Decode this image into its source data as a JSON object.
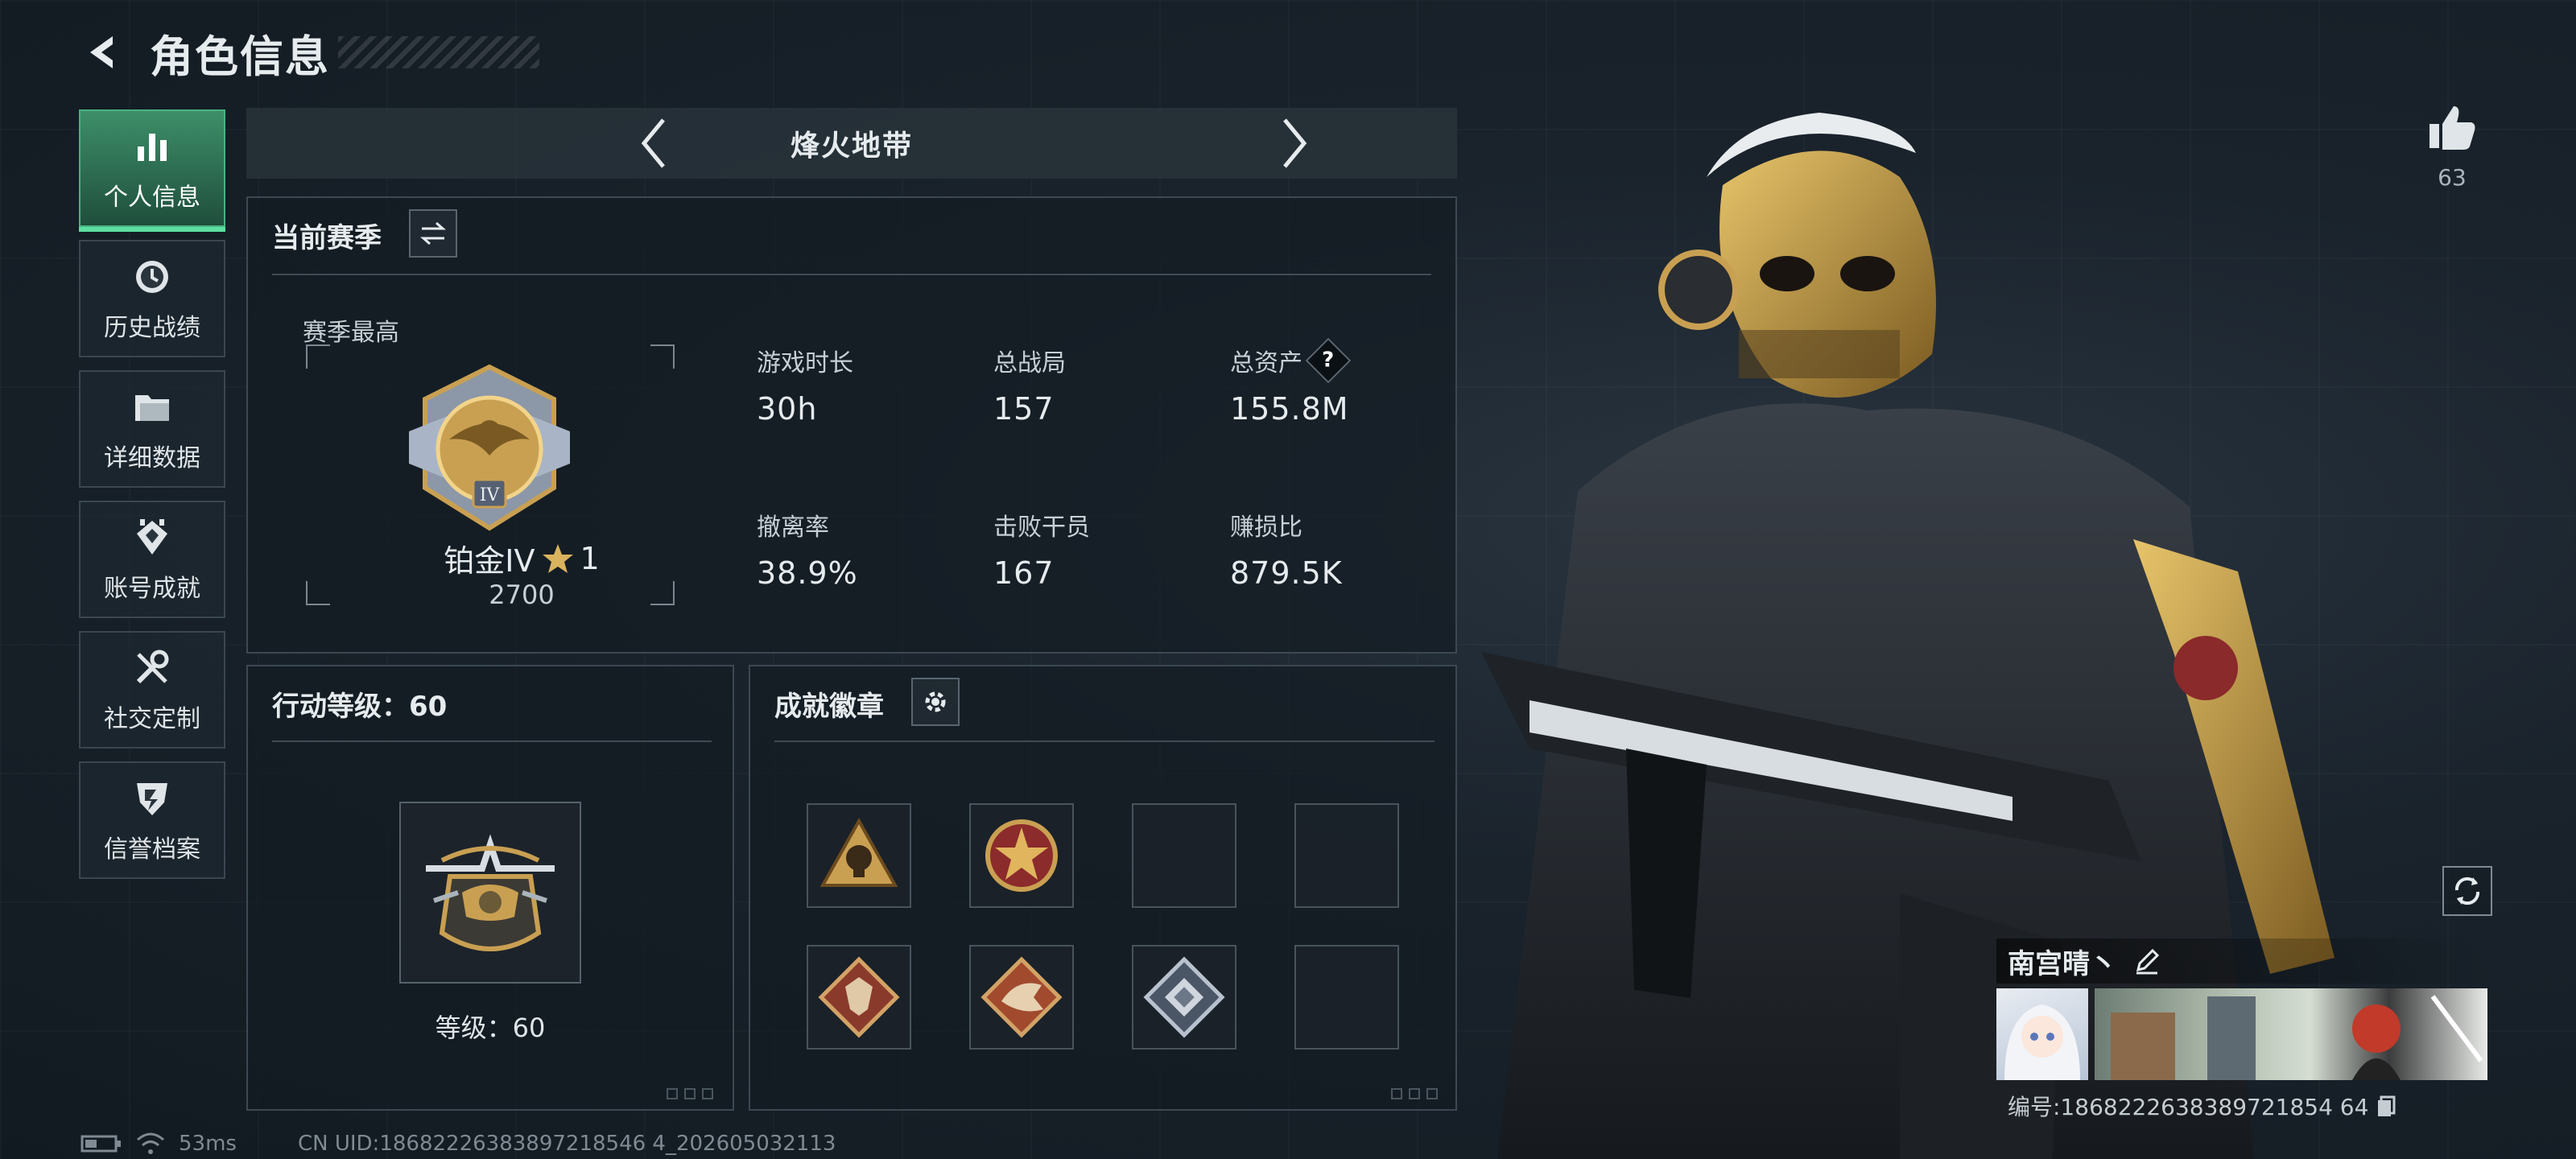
{
  "header": {
    "title": "角色信息"
  },
  "sidebar": {
    "items": [
      {
        "label": "个人信息",
        "icon": "bar-chart-icon",
        "active": true
      },
      {
        "label": "历史战绩",
        "icon": "clock-icon",
        "active": false
      },
      {
        "label": "详细数据",
        "icon": "folder-icon",
        "active": false
      },
      {
        "label": "账号成就",
        "icon": "achievement-icon",
        "active": false
      },
      {
        "label": "社交定制",
        "icon": "tools-icon",
        "active": false
      },
      {
        "label": "信誉档案",
        "icon": "shield-icon",
        "active": false
      }
    ]
  },
  "mode": {
    "name": "烽火地带"
  },
  "season": {
    "title": "当前赛季",
    "best_label": "赛季最高",
    "rank_name": "铂金IV",
    "rank_stars": "1",
    "rank_score": "2700",
    "rank_emblem_numeral": "IV",
    "stats": [
      {
        "label": "游戏时长",
        "value": "30h",
        "help": false
      },
      {
        "label": "总战局",
        "value": "157",
        "help": false
      },
      {
        "label": "总资产",
        "value": "155.8M",
        "help": true
      },
      {
        "label": "撤离率",
        "value": "38.9%",
        "help": false
      },
      {
        "label": "击败干员",
        "value": "167",
        "help": false
      },
      {
        "label": "赚损比",
        "value": "879.5K",
        "help": false
      }
    ],
    "help_glyph": "?"
  },
  "action_level": {
    "title": "行动等级：60",
    "level_text": "等级：60"
  },
  "badges": {
    "title": "成就徽章",
    "slots": [
      {
        "icon": "skull-triangle-badge-icon",
        "filled": true
      },
      {
        "icon": "star-roundel-badge-icon",
        "filled": true
      },
      {
        "icon": "empty-slot",
        "filled": false
      },
      {
        "icon": "empty-slot",
        "filled": false
      },
      {
        "icon": "wolf-diamond-badge-icon",
        "filled": true
      },
      {
        "icon": "raptor-diamond-badge-icon",
        "filled": true
      },
      {
        "icon": "crate-diamond-badge-icon",
        "filled": true
      },
      {
        "icon": "empty-slot",
        "filled": false
      }
    ]
  },
  "profile": {
    "like_count": "63",
    "player_name": "南宫晴丶",
    "player_id": "编号:1868222638389721854 64"
  },
  "footer": {
    "ping": "53ms",
    "uid": "CN UID:18682226383897218546 4_202605032113"
  },
  "colors": {
    "accent_green": "#49b283",
    "gold": "#c9a052",
    "panel_border": "#3c4852"
  }
}
